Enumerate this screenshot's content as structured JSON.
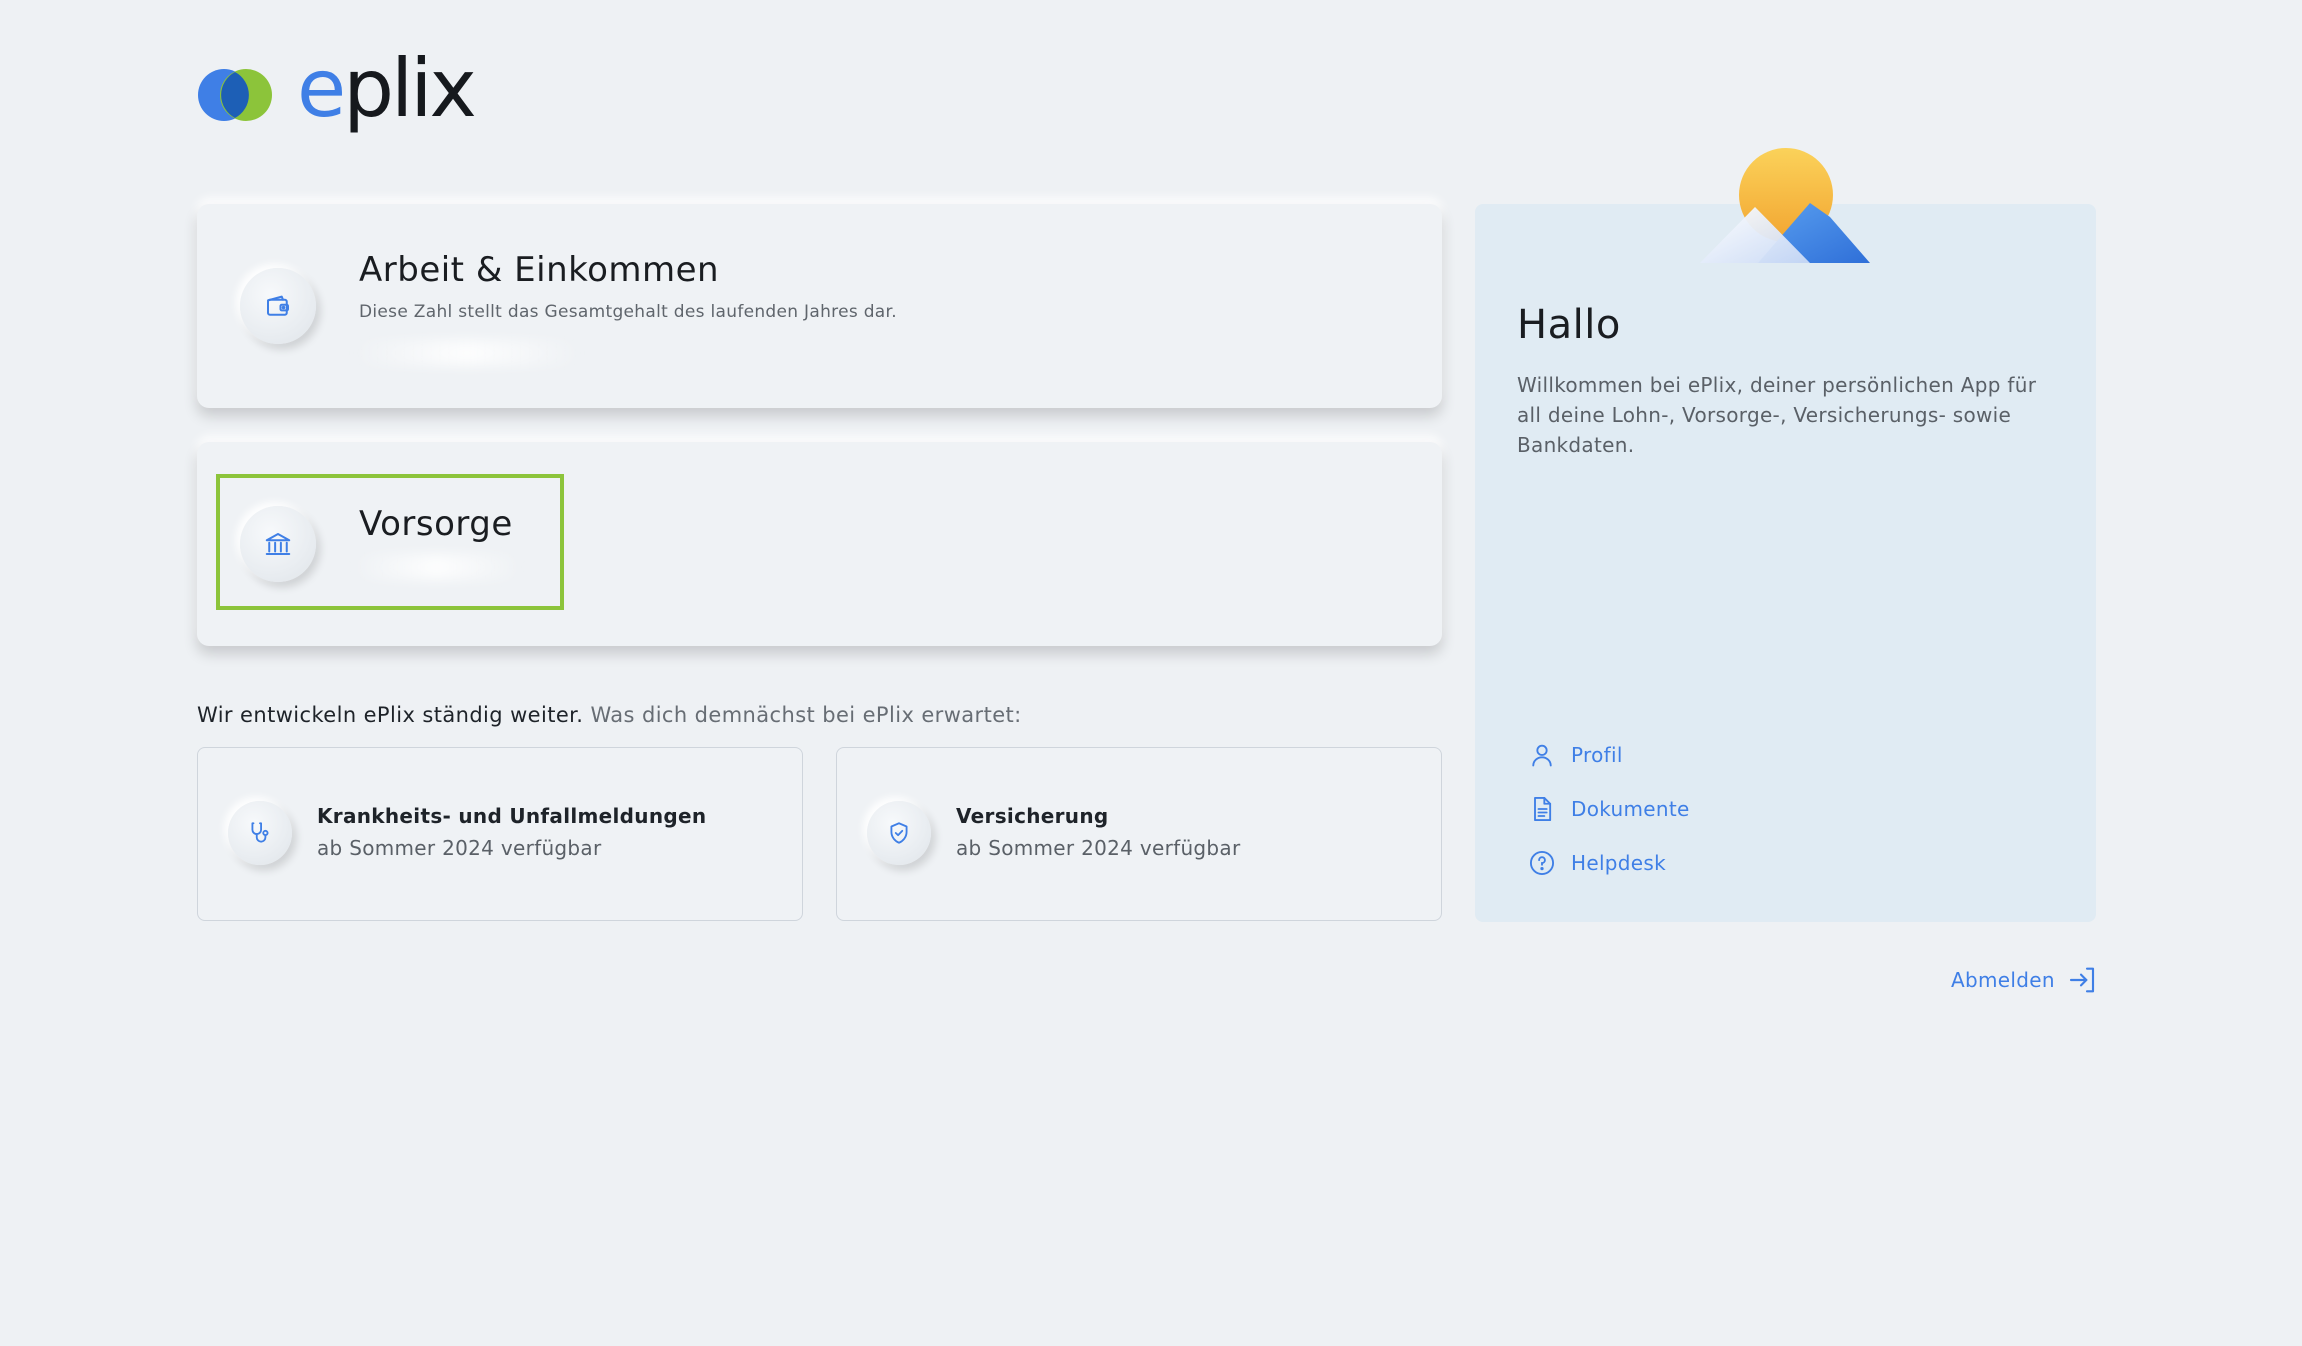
{
  "brand": {
    "logo_text_accent": "e",
    "logo_text_rest": "plix",
    "accent_color": "#3f7fe6",
    "logo_green": "#8cc43a"
  },
  "cards": {
    "work": {
      "title": "Arbeit & Einkommen",
      "subtitle": "Diese Zahl stellt das Gesamtgehalt des laufenden Jahres dar.",
      "icon": "wallet-icon"
    },
    "vorsorge": {
      "title": "Vorsorge",
      "icon": "bank-icon"
    }
  },
  "coming_soon": {
    "intro_strong": "Wir entwickeln ePlix ständig weiter.",
    "intro_light": "Was dich demnächst bei ePlix erwartet:",
    "items": [
      {
        "title": "Krankheits- und Unfallmeldungen",
        "subtitle": "ab Sommer 2024 verfügbar",
        "icon": "stethoscope-icon"
      },
      {
        "title": "Versicherung",
        "subtitle": "ab Sommer 2024 verfügbar",
        "icon": "shield-check-icon"
      }
    ]
  },
  "panel": {
    "greeting": "Hallo",
    "welcome": "Willkommen bei ePlix, deiner persönlichen App für all deine Lohn-, Vorsorge-, Versicherungs- sowie Bankdaten.",
    "links": [
      {
        "label": "Profil",
        "icon": "user-icon"
      },
      {
        "label": "Dokumente",
        "icon": "document-icon"
      },
      {
        "label": "Helpdesk",
        "icon": "help-circle-icon"
      }
    ]
  },
  "logout": {
    "label": "Abmelden",
    "icon": "logout-icon"
  }
}
